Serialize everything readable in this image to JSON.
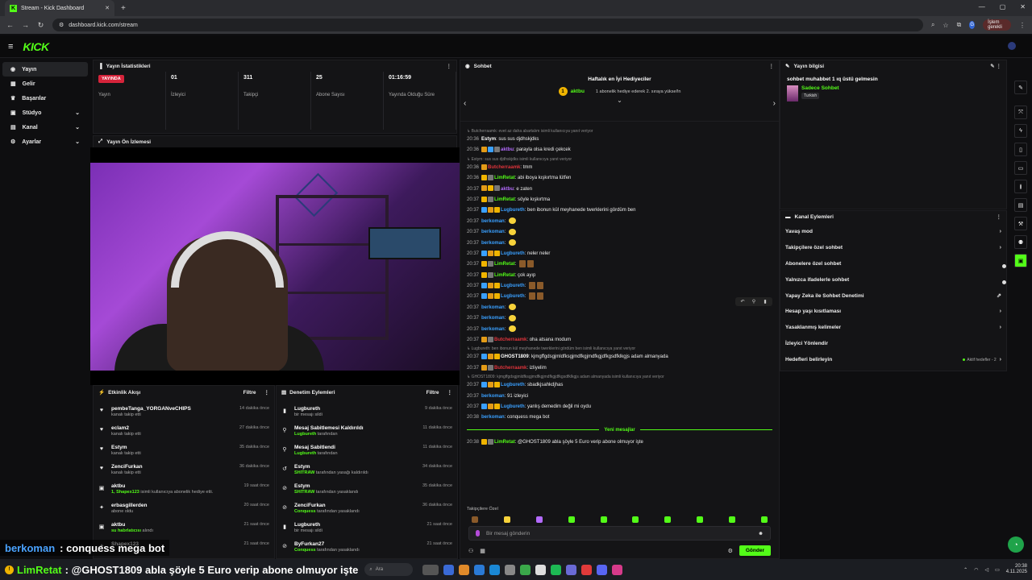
{
  "browser": {
    "tab_title": "Stream - Kick Dashboard",
    "url": "dashboard.kick.com/stream",
    "profile_initial": "G",
    "paused_label": "İşlem gerekli"
  },
  "app": {
    "logo": "KICK"
  },
  "sidebar": {
    "items": [
      {
        "label": "Yayın",
        "icon": "broadcast-icon",
        "active": true
      },
      {
        "label": "Gelir",
        "icon": "money-icon"
      },
      {
        "label": "Başarılar",
        "icon": "trophy-icon"
      },
      {
        "label": "Stüdyo",
        "icon": "studio-icon",
        "expandable": true
      },
      {
        "label": "Kanal",
        "icon": "channel-icon",
        "expandable": true
      },
      {
        "label": "Ayarlar",
        "icon": "settings-icon",
        "expandable": true
      }
    ]
  },
  "stats": {
    "title": "Yayın İstatistikleri",
    "items": [
      {
        "value": "YAYINDA",
        "label": "Yayın",
        "live": true
      },
      {
        "value": "01",
        "label": "İzleyici"
      },
      {
        "value": "311",
        "label": "Takipçi"
      },
      {
        "value": "25",
        "label": "Abone Sayısı"
      },
      {
        "value": "01:16:59",
        "label": "Yayında Olduğu Süre"
      }
    ]
  },
  "preview": {
    "title": "Yayın Ön İzlemesi"
  },
  "activity": {
    "title": "Etkinlik Akışı",
    "filter": "Filtre",
    "rows": [
      {
        "icon": "heart-icon",
        "name": "pembeTanga_YORGANveCHIPS",
        "desc": "kanalı takip etti",
        "time": "14 dakika önce"
      },
      {
        "icon": "heart-icon",
        "name": "eclam2",
        "desc": "kanalı takip etti",
        "time": "27 dakika önce"
      },
      {
        "icon": "heart-icon",
        "name": "Estym",
        "desc": "kanalı takip etti",
        "time": "35 dakika önce"
      },
      {
        "icon": "heart-icon",
        "name": "ZenciFurkan",
        "desc": "kanalı takip etti",
        "time": "36 dakika önce"
      },
      {
        "icon": "gift-icon",
        "name": "aktbu",
        "desc_hl": "1, Shapex123",
        "desc": "isimli kullanıcıya abonelik hediye etti.",
        "time": "19 saat önce"
      },
      {
        "icon": "star-icon",
        "name": "erbasgillerden",
        "desc": "abone oldu",
        "time": "20 saat önce"
      },
      {
        "icon": "gift-icon",
        "name": "aktbu",
        "desc_hl": "su habrlatıcısı",
        "desc": "alındı",
        "time": "21 saat önce"
      },
      {
        "icon": "star-icon",
        "name": "Shapex123",
        "desc": "",
        "time": "21 saat önce"
      }
    ]
  },
  "moderation": {
    "title": "Denetim Eylemleri",
    "filter": "Filtre",
    "rows": [
      {
        "icon": "trash-icon",
        "name": "Lugbureth",
        "desc_hl": "",
        "desc": "bir mesajı sildi",
        "time": "9 dakika önce"
      },
      {
        "icon": "unpin-icon",
        "name": "Mesaj Sabitlemesi Kaldırıldı",
        "desc_hl": "Lugbureth",
        "desc": "tarafından",
        "time": "11 dakika önce"
      },
      {
        "icon": "pin-icon",
        "name": "Mesaj Sabitlendi",
        "desc_hl": "Lugbureth",
        "desc": "tarafından",
        "time": "11 dakika önce"
      },
      {
        "icon": "undo-icon",
        "name": "Estym",
        "desc_hl": "SHITRAW",
        "desc": "tarafından yasağı kaldırıldı",
        "time": "34 dakika önce"
      },
      {
        "icon": "ban-icon",
        "name": "Estym",
        "desc_hl": "SHITRAW",
        "desc": "tarafından yasaklandı",
        "time": "35 dakika önce"
      },
      {
        "icon": "ban-icon",
        "name": "ZenciFurkan",
        "desc_hl": "Conquess",
        "desc": "tarafından yasaklandı",
        "time": "36 dakika önce"
      },
      {
        "icon": "trash-icon",
        "name": "Lugbureth",
        "desc_hl": "",
        "desc": "bir mesajı sildi",
        "time": "21 saat önce"
      },
      {
        "icon": "ban-icon",
        "name": "ByFurkan27",
        "desc_hl": "Conquess",
        "desc": "tarafından yasaklandı",
        "time": "21 saat önce"
      }
    ]
  },
  "chat": {
    "title": "Sohbet",
    "gift_title": "Haftalık en İyi Hediyeciler",
    "gifter_rank": "1",
    "gifter_name": "aktbu",
    "gifter_count": "1",
    "gift_desc": "1 abonelik hediye ederek 2. sıraya yüksel!n",
    "new_messages": "Yeni mesajlar",
    "messages": [
      {
        "reply": "↳ Butcherraamk: evet az daha abartalım isimli kullanıcıya yanıt veriyor"
      },
      {
        "time": "20:36",
        "user": "Estym",
        "color": "#ffffff",
        "text": "sus sus djdhskjdks"
      },
      {
        "time": "20:36",
        "user": "aktbu",
        "color": "#b46bff",
        "text": "parayla olsa kredi çekcek",
        "badges": [
          "#e39b17",
          "#3aa0ff",
          "#777"
        ]
      },
      {
        "reply": "↳ Estym: sus sus djdhskjdks isimli kullanıcıya yanıt veriyor"
      },
      {
        "time": "20:36",
        "user": "Butcherraamk",
        "color": "#e0343b",
        "text": "tmm",
        "badges": [
          "#e39b17"
        ]
      },
      {
        "time": "20:36",
        "user": "LimRetat",
        "color": "#53fc18",
        "text": "abi iboya kışkırtma lütfen",
        "badges": [
          "#f0b400",
          "#777"
        ]
      },
      {
        "time": "20:37",
        "user": "aktbu",
        "color": "#b46bff",
        "text": "e zaten",
        "badges": [
          "#e39b17",
          "#f0b400",
          "#777"
        ]
      },
      {
        "time": "20:37",
        "user": "LimRetat",
        "color": "#53fc18",
        "text": "söyle kışkırtma",
        "badges": [
          "#f0b400",
          "#777"
        ]
      },
      {
        "time": "20:37",
        "user": "Lugbureth",
        "color": "#3aa0ff",
        "text": "ben ibonun kül meyhanede twerklerini gördüm ben",
        "badges": [
          "#3aa0ff",
          "#e39b17",
          "#f0b400"
        ]
      },
      {
        "time": "20:37",
        "user": "berkoman",
        "color": "#3aa0ff",
        "text": "",
        "emo": "smile"
      },
      {
        "time": "20:37",
        "user": "berkoman",
        "color": "#3aa0ff",
        "text": "",
        "emo": "smile"
      },
      {
        "time": "20:37",
        "user": "berkoman",
        "color": "#3aa0ff",
        "text": "",
        "emo": "smile"
      },
      {
        "time": "20:37",
        "user": "Lugbureth",
        "color": "#3aa0ff",
        "text": "neler neler",
        "badges": [
          "#3aa0ff",
          "#e39b17",
          "#f0b400"
        ]
      },
      {
        "time": "20:37",
        "user": "LimRetat",
        "color": "#53fc18",
        "text": "",
        "badges": [
          "#f0b400",
          "#777"
        ],
        "emo": "mug"
      },
      {
        "time": "20:37",
        "user": "LimRetat",
        "color": "#53fc18",
        "text": "çok ayıp",
        "badges": [
          "#f0b400",
          "#777"
        ]
      },
      {
        "time": "20:37",
        "user": "Lugbureth",
        "color": "#3aa0ff",
        "text": "",
        "badges": [
          "#3aa0ff",
          "#e39b17",
          "#f0b400"
        ],
        "emo": "mug"
      },
      {
        "time": "20:37",
        "user": "Lugbureth",
        "color": "#3aa0ff",
        "text": "",
        "badges": [
          "#3aa0ff",
          "#e39b17",
          "#f0b400"
        ],
        "emo": "mug"
      },
      {
        "time": "20:37",
        "user": "berkoman",
        "color": "#3aa0ff",
        "text": "",
        "emo": "smile"
      },
      {
        "time": "20:37",
        "user": "berkoman",
        "color": "#3aa0ff",
        "text": "",
        "emo": "smile"
      },
      {
        "time": "20:37",
        "user": "berkoman",
        "color": "#3aa0ff",
        "text": "",
        "emo": "smile"
      },
      {
        "time": "20:37",
        "user": "Butcherraamk",
        "color": "#e0343b",
        "text": "oha atsana modum",
        "badges": [
          "#e39b17",
          "#777"
        ]
      },
      {
        "reply": "↳ Lugbureth: ben ibonun kül meyhanede twerklerini gördüm ben isimli kullanıcıya yanıt veriyor"
      },
      {
        "time": "20:37",
        "user": "GHOST1809",
        "color": "#ffffff",
        "text": "kjmgffgdsgjmldfksgjmdfkgjmdfkgjdfkgsdfklkgjs adam almanyada",
        "badges": [
          "#3aa0ff",
          "#e39b17",
          "#f0b400"
        ]
      },
      {
        "time": "20:37",
        "user": "Butcherraamk",
        "color": "#e0343b",
        "text": "izliyelim",
        "badges": [
          "#e39b17",
          "#777"
        ]
      },
      {
        "reply": "↳ GHOST1809: kjmgffgdsgjmldfksgjmdfkgjmdfkgjdfkgsdfklkgjs adam almanyada isimli kullanıcıya yanıt veriyor"
      },
      {
        "time": "20:37",
        "user": "Lugbureth",
        "color": "#3aa0ff",
        "text": "sbadkjsahkdjhas",
        "badges": [
          "#3aa0ff",
          "#e39b17",
          "#f0b400"
        ]
      },
      {
        "time": "20:37",
        "user": "berkoman",
        "color": "#3aa0ff",
        "text": "91 izleyici"
      },
      {
        "time": "20:37",
        "user": "Lugbureth",
        "color": "#3aa0ff",
        "text": "yanlış demedim değil mi oydu",
        "badges": [
          "#3aa0ff",
          "#e39b17",
          "#f0b400"
        ]
      },
      {
        "time": "20:38",
        "user": "berkoman",
        "color": "#3aa0ff",
        "text": "conquess mega bot"
      }
    ],
    "after_new": [
      {
        "time": "20:38",
        "user": "LimRetat",
        "color": "#53fc18",
        "text": "@GHOST1809 abla şöyle 5 Euro verip abone olmuyor işte",
        "badges": [
          "#f0b400",
          "#777"
        ]
      }
    ],
    "mode_label": "Takipçilere Özel",
    "placeholder": "Bir mesaj gönderin",
    "send": "Gönder",
    "emote_colors": [
      "#8a5a2a",
      "#f7d23a",
      "#b46bff",
      "#53fc18",
      "#53fc18",
      "#53fc18",
      "#53fc18",
      "#53fc18",
      "#53fc18",
      "#53fc18"
    ]
  },
  "stream_info": {
    "title": "Yayın bilgisi",
    "stream_title": "sohbet muhabbet 1 ıq üstü gelmesin",
    "category": "Sadece Sohbet",
    "tag": "Turkish"
  },
  "channel_actions": {
    "title": "Kanal Eylemleri",
    "items": [
      {
        "label": "Yavaş mod",
        "control": "chevron"
      },
      {
        "label": "Takipçilere özel sohbet",
        "control": "chevron"
      },
      {
        "label": "Abonelere özel sohbet",
        "control": "toggle"
      },
      {
        "label": "Yalnızca ifadelerle sohbet",
        "control": "toggle"
      },
      {
        "label": "Yapay Zeka ile Sohbet Denetimi",
        "control": "external"
      },
      {
        "label": "Hesap yaşı kısıtlaması",
        "control": "chevron"
      },
      {
        "label": "Yasaklanmış kelimeler",
        "control": "chevron"
      },
      {
        "label": "İzleyici Yönlendir",
        "control": "none"
      },
      {
        "label": "Hedefleri belirleyin",
        "control": "chevron",
        "extra": "Aktif hedefler - 2"
      }
    ]
  },
  "overlay": {
    "line1_user": "berkoman",
    "line1_text": ": conquess mega bot",
    "line2_user": "LimRetat",
    "line2_text": ": @GHOST1809 abla şöyle 5 Euro verip abone olmuyor işte"
  },
  "taskbar": {
    "search": "Ara",
    "time": "20:38",
    "date": "4.11.2025"
  }
}
